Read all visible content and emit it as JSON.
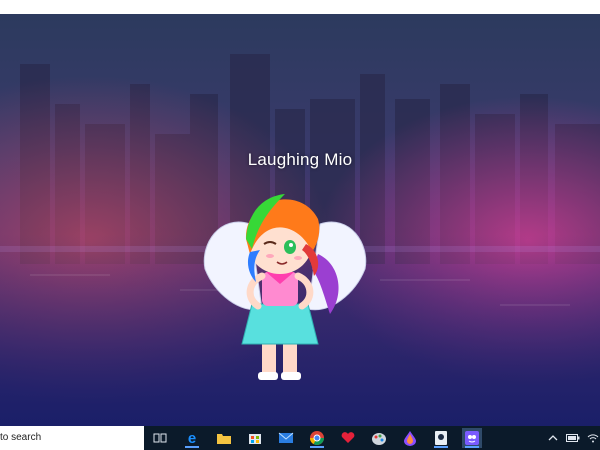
{
  "app": {
    "character_name": "Laughing Mio"
  },
  "taskbar": {
    "search_text": "to search",
    "icons": [
      "task-view-icon",
      "edge-icon",
      "file-explorer-icon",
      "store-icon",
      "mail-icon",
      "chrome-icon",
      "heart-app-icon",
      "paint-app-icon",
      "drop-app-icon",
      "tablet-app-icon",
      "gacha-app-icon"
    ],
    "tray": [
      "chevron-up-icon",
      "battery-icon",
      "wifi-icon"
    ]
  },
  "colors": {
    "taskbar_bg": "#0b1a2a",
    "accent": "#5aa0ff",
    "scene_top": "#2b2f55",
    "scene_bottom": "#1d1e5a"
  }
}
